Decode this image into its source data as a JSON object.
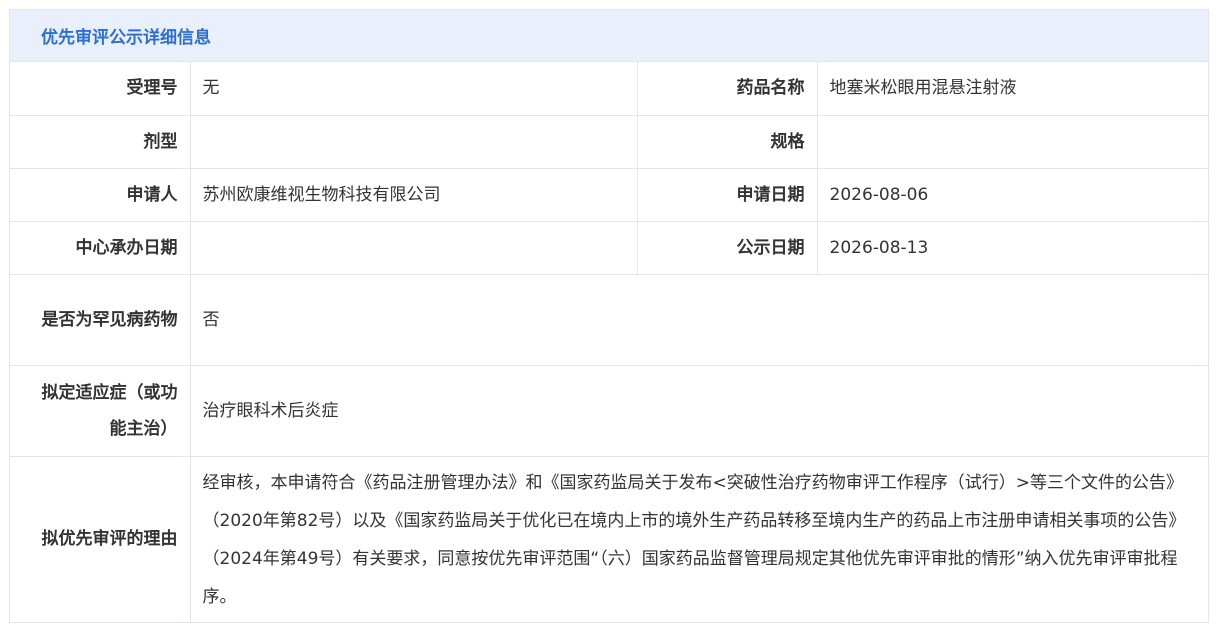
{
  "header": {
    "title": "优先审评公示详细信息"
  },
  "fields": {
    "acceptance_no": {
      "label": "受理号",
      "value": "无"
    },
    "drug_name": {
      "label": "药品名称",
      "value": "地塞米松眼用混悬注射液"
    },
    "dosage_form": {
      "label": "剂型",
      "value": ""
    },
    "specification": {
      "label": "规格",
      "value": ""
    },
    "applicant": {
      "label": "申请人",
      "value": "苏州欧康维视生物科技有限公司"
    },
    "application_date": {
      "label": "申请日期",
      "value": "2026-08-06"
    },
    "center_date": {
      "label": "中心承办日期",
      "value": ""
    },
    "publication_date": {
      "label": "公示日期",
      "value": "2026-08-13"
    },
    "rare_disease": {
      "label": "是否为罕见病药物",
      "value": "否"
    },
    "indication": {
      "label": "拟定适应症（或功能主治）",
      "value": "治疗眼科术后炎症"
    },
    "reason": {
      "label": "拟优先审评的理由",
      "value": "经审核，本申请符合《药品注册管理办法》和《国家药监局关于发布<突破性治疗药物审评工作程序（试行）>等三个文件的公告》（2020年第82号）以及《国家药监局关于优化已在境内上市的境外生产药品转移至境内生产的药品上市注册申请相关事项的公告》（2024年第49号）有关要求，同意按优先审评范围“（六）国家药品监督管理局规定其他优先审评审批的情形”纳入优先审评审批程序。"
    }
  }
}
